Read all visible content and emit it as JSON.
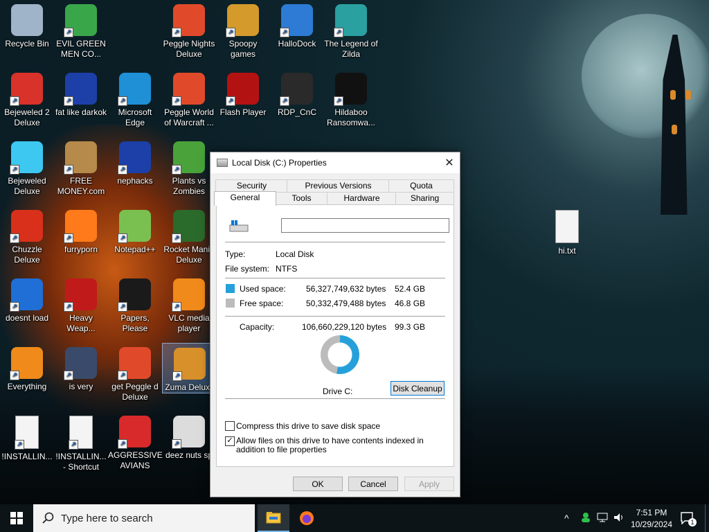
{
  "desktop": {
    "icons": [
      {
        "label": "Recycle Bin",
        "icon": "recycle-bin-icon"
      },
      {
        "label": "EVIL GREEN MEN CO...",
        "icon": "people-icon"
      },
      {
        "label": "Peggle Nights Deluxe",
        "icon": "peggle-icon"
      },
      {
        "label": "Spoopy games",
        "icon": "folder-icon"
      },
      {
        "label": "HalloDock",
        "icon": "windows-logo-icon"
      },
      {
        "label": "The Legend of Zilda",
        "icon": "character-icon"
      },
      {
        "label": "Bejeweled 2 Deluxe",
        "icon": "gem-icon"
      },
      {
        "label": "fat like darkok",
        "icon": "mpi-icon"
      },
      {
        "label": "Microsoft Edge",
        "icon": "edge-icon"
      },
      {
        "label": "Peggle World of Warcraft ...",
        "icon": "peggle-icon"
      },
      {
        "label": "Flash Player",
        "icon": "flash-icon"
      },
      {
        "label": "RDP_CnC",
        "icon": "rdp-icon"
      },
      {
        "label": "Hildaboo Ransomwa...",
        "icon": "ransomware-icon"
      },
      {
        "label": "Bejeweled Deluxe",
        "icon": "diamond-icon"
      },
      {
        "label": "FREE MONEY.com",
        "icon": "money-bag-icon"
      },
      {
        "label": "nephacks",
        "icon": "mpi-icon"
      },
      {
        "label": "Plants vs Zombies",
        "icon": "plant-icon"
      },
      {
        "label": "Chuzzle Deluxe",
        "icon": "chuzzle-icon"
      },
      {
        "label": "furryporn",
        "icon": "firefox-icon"
      },
      {
        "label": "Notepad++",
        "icon": "notepad-icon"
      },
      {
        "label": "Rocket Mania Deluxe",
        "icon": "rocket-icon"
      },
      {
        "label": "doesnt load",
        "icon": "thunderbird-icon"
      },
      {
        "label": "Heavy Weap...",
        "icon": "radiation-icon"
      },
      {
        "label": "Papers, Please",
        "icon": "papers-icon"
      },
      {
        "label": "VLC media player",
        "icon": "vlc-icon"
      },
      {
        "label": "Everything",
        "icon": "search-ring-icon"
      },
      {
        "label": "is very",
        "icon": "mpi-shield-icon"
      },
      {
        "label": "get Peggle d Deluxe",
        "icon": "peggle-icon"
      },
      {
        "label": "Zuma Deluxe",
        "icon": "zuma-icon"
      },
      {
        "label": "!INSTALLIN...",
        "icon": "document-icon"
      },
      {
        "label": "!INSTALLIN... - Shortcut",
        "icon": "document-icon"
      },
      {
        "label": "AGGRESSIVE AVIANS",
        "icon": "angry-bird-icon"
      },
      {
        "label": "deez nuts sp",
        "icon": "windows-stack-icon"
      },
      {
        "label": "hi.txt",
        "icon": "text-file-icon"
      }
    ]
  },
  "dialog": {
    "title": "Local Disk (C:) Properties",
    "close_glyph": "✕",
    "tabs_row1": [
      "Security",
      "Previous Versions",
      "Quota"
    ],
    "tabs_row2": [
      "General",
      "Tools",
      "Hardware",
      "Sharing"
    ],
    "active_tab": "General",
    "name_value": "",
    "type_label": "Type:",
    "type_value": "Local Disk",
    "fs_label": "File system:",
    "fs_value": "NTFS",
    "used_label": "Used space:",
    "used_bytes": "56,327,749,632 bytes",
    "used_gb": "52.4 GB",
    "free_label": "Free space:",
    "free_bytes": "50,332,479,488 bytes",
    "free_gb": "46.8 GB",
    "capacity_label": "Capacity:",
    "capacity_bytes": "106,660,229,120 bytes",
    "capacity_gb": "99.3 GB",
    "used_fraction": 0.528,
    "used_color": "#26a0da",
    "free_color": "#bcbcbc",
    "drive_label": "Drive C:",
    "disk_cleanup": "Disk Cleanup",
    "compress_label": "Compress this drive to save disk space",
    "compress_checked": false,
    "index_label": "Allow files on this drive to have contents indexed in addition to file properties",
    "index_checked": true,
    "ok": "OK",
    "cancel": "Cancel",
    "apply": "Apply"
  },
  "taskbar": {
    "search_placeholder": "Type here to search",
    "time": "7:51 PM",
    "date": "10/29/2024",
    "notification_count": "1"
  }
}
